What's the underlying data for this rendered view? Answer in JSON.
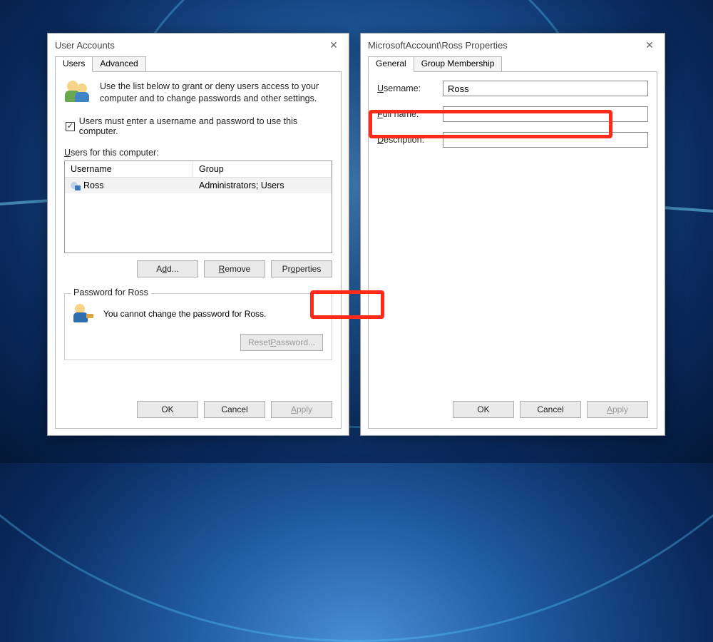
{
  "left": {
    "title": "User Accounts",
    "tabs": {
      "users": "Users",
      "advanced": "Advanced"
    },
    "intro": "Use the list below to grant or deny users access to your computer and to change passwords and other settings.",
    "checkbox_label_pre": "Users must ",
    "checkbox_label_u": "e",
    "checkbox_label_post": "nter a username and password to use this computer.",
    "users_for": "Users for this computer:",
    "col_username": "Username",
    "col_group": "Group",
    "row_username": "Ross",
    "row_group": "Administrators; Users",
    "add_btn": "Add...",
    "remove_btn": "Remove",
    "properties_btn": "Properties",
    "pw_legend": "Password for Ross",
    "pw_text": "You cannot change the password for Ross.",
    "reset_btn": "Reset Password...",
    "ok": "OK",
    "cancel": "Cancel",
    "apply": "Apply"
  },
  "right": {
    "title": "MicrosoftAccount\\Ross Properties",
    "tabs": {
      "general": "General",
      "group": "Group Membership"
    },
    "username_label": "Username:",
    "username_value": "Ross",
    "fullname_label": "Full name:",
    "fullname_value": "",
    "description_label": "Description:",
    "description_value": "",
    "ok": "OK",
    "cancel": "Cancel",
    "apply": "Apply"
  }
}
